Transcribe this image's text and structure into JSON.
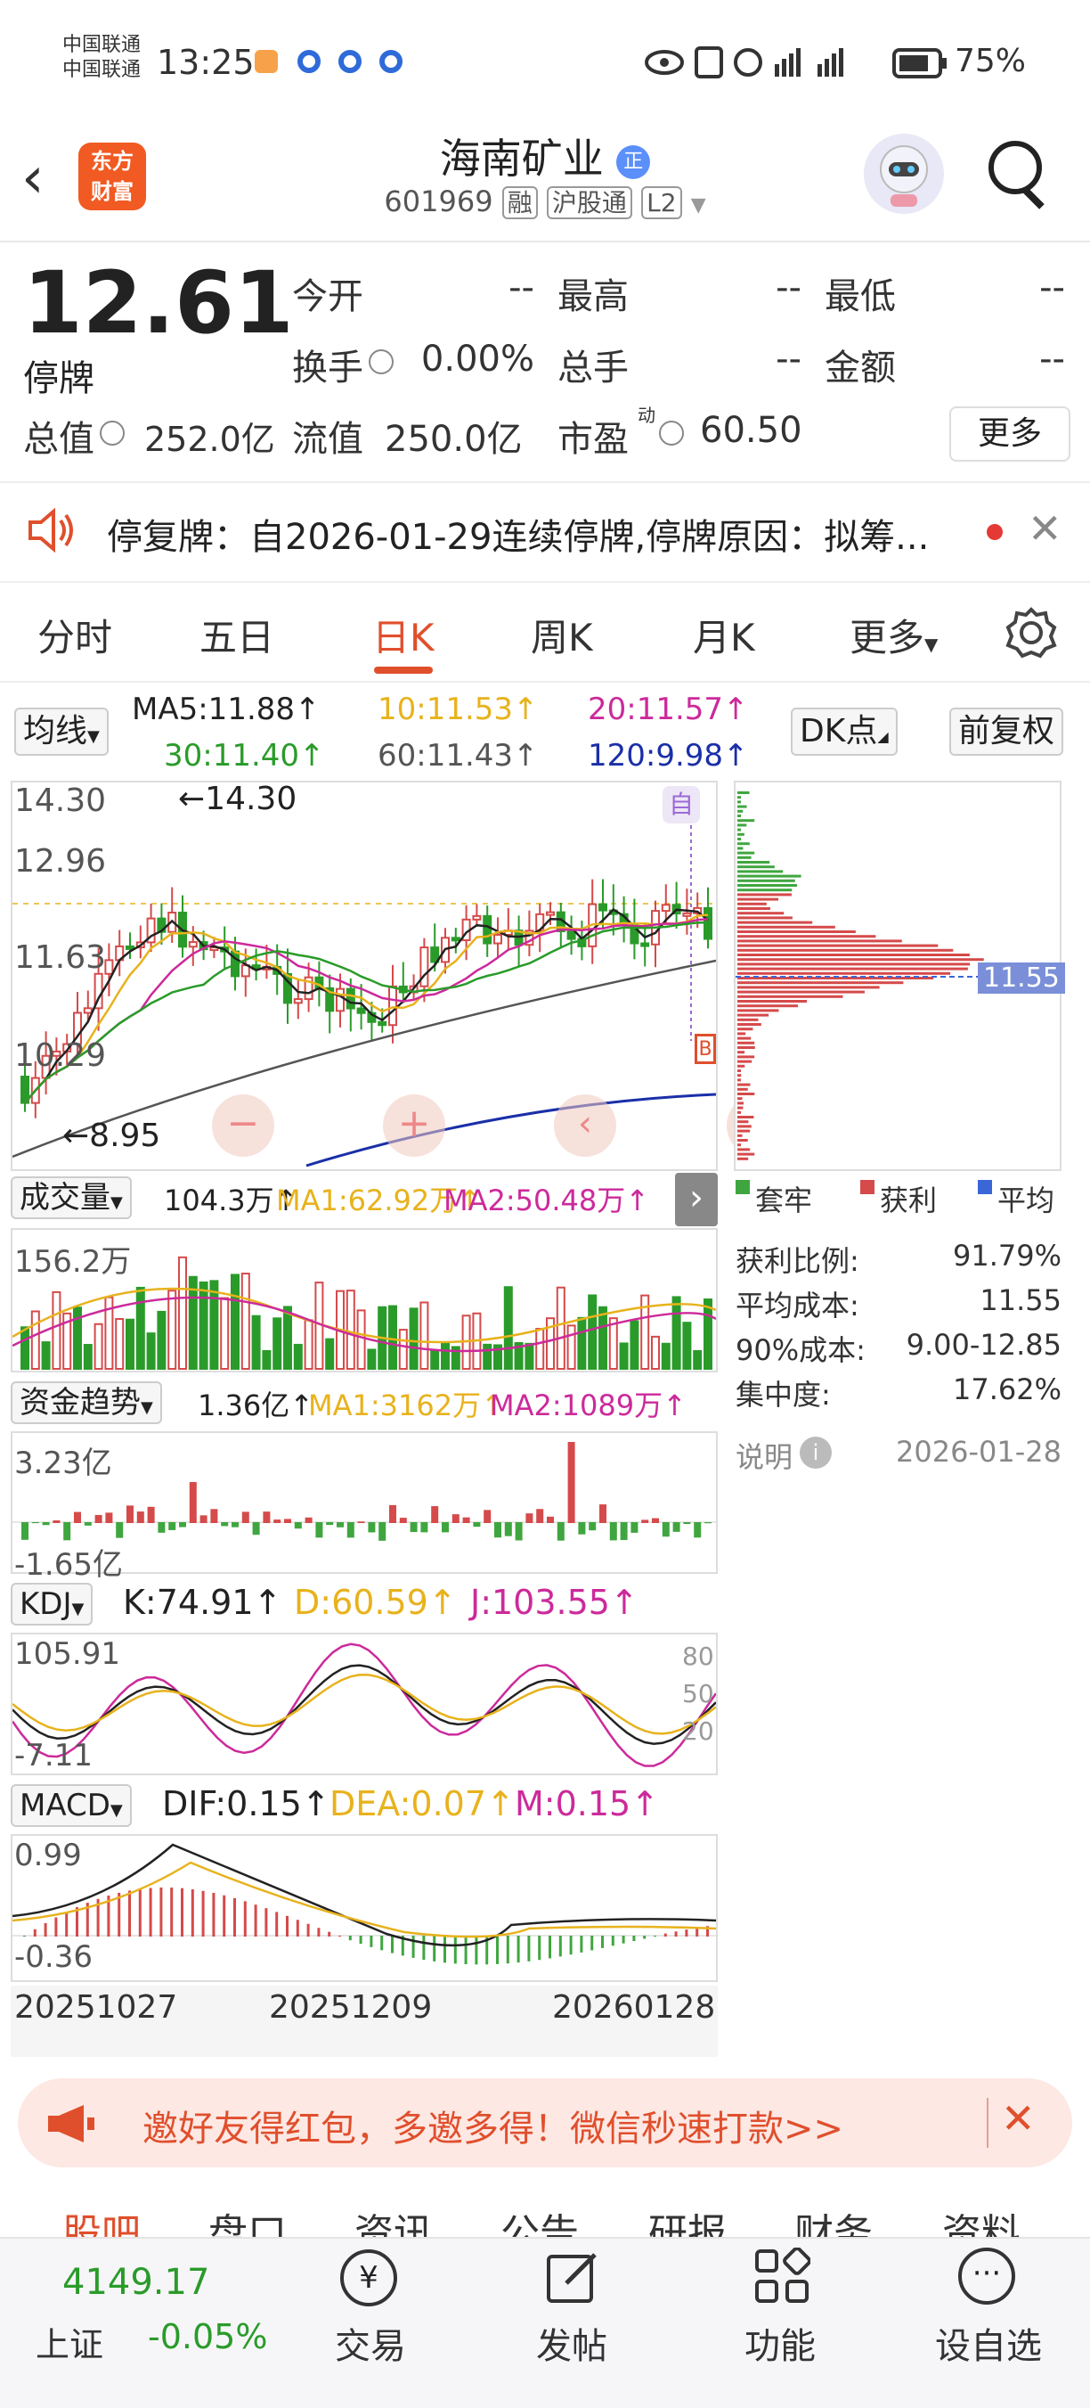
{
  "status": {
    "carrier1": "中国联通",
    "carrier2": "中国联通",
    "time": "13:25",
    "battery": "75%"
  },
  "header": {
    "title": "海南矿业",
    "badge": "正",
    "code": "601969",
    "tag_margin": "融",
    "tag_connect": "沪股通",
    "tag_level": "L2",
    "logo_line1": "东方",
    "logo_line2": "财富"
  },
  "quote": {
    "price": "12.61",
    "status": "停牌",
    "open_label": "今开",
    "open_value": "--",
    "high_label": "最高",
    "high_value": "--",
    "low_label": "最低",
    "low_value": "--",
    "turnover_label": "换手",
    "turnover_value": "0.00%",
    "volume_label": "总手",
    "volume_value": "--",
    "amount_label": "金额",
    "amount_value": "--",
    "mktcap_label": "总值",
    "mktcap_value": "252.0亿",
    "float_label": "流值",
    "float_value": "250.0亿",
    "pe_label": "市盈",
    "pe_sup": "动",
    "pe_value": "60.50",
    "more_label": "更多"
  },
  "notice": {
    "text": "停复牌：自2026-01-29连续停牌,停牌原因：拟筹..."
  },
  "tabs": [
    "分时",
    "五日",
    "日K",
    "周K",
    "月K",
    "更多"
  ],
  "active_tab": "日K",
  "ma_line": {
    "selector": "均线",
    "ma5": "MA5:11.88↑",
    "ma10": "10:11.53↑",
    "ma20": "20:11.57↑",
    "ma30": "30:11.40↑",
    "ma60": "60:11.43↑",
    "ma120": "120:9.98↑",
    "dk_label": "DK点",
    "fq_label": "前复权",
    "colors": {
      "ma5": "#222222",
      "ma10": "#e8b21c",
      "ma20": "#cc2a9b",
      "ma30": "#2a9b2a",
      "ma60": "#555555",
      "ma120": "#1a2fa8"
    }
  },
  "kchart": {
    "y_ticks": [
      "14.30",
      "12.96",
      "11.63",
      "10.29",
      "8.95"
    ],
    "high_annotation": "←14.30",
    "low_annotation": "←8.95",
    "auto_label": "自",
    "b_label": "B"
  },
  "volume": {
    "selector": "成交量",
    "value": "104.3万↑",
    "ma1": "MA1:62.92万↑",
    "ma2": "MA2:50.48万↑",
    "top_tick": "156.2万"
  },
  "fund": {
    "selector": "资金趋势",
    "value": "1.36亿↑",
    "ma1": "MA1:3162万↑",
    "ma2": "MA2:1089万↑",
    "top_tick": "3.23亿",
    "bottom_tick": "-1.65亿"
  },
  "kdj": {
    "selector": "KDJ",
    "k": "K:74.91↑",
    "d": "D:60.59↑",
    "j": "J:103.55↑",
    "top_tick": "105.91",
    "bottom_tick": "-7.11",
    "r80": "80",
    "r50": "50",
    "r20": "20"
  },
  "macd": {
    "selector": "MACD",
    "dif": "DIF:0.15↑",
    "dea": "DEA:0.07↑",
    "m": "M:0.15↑",
    "top_tick": "0.99",
    "bottom_tick": "-0.36",
    "dates": [
      "20251027",
      "20251209",
      "20260128"
    ]
  },
  "chip": {
    "avg_label": "11.55",
    "legend_trapped": "套牢",
    "legend_profit": "获利",
    "legend_avg": "平均",
    "profit_ratio_label": "获利比例:",
    "profit_ratio_value": "91.79%",
    "avg_cost_label": "平均成本:",
    "avg_cost_value": "11.55",
    "cost90_label": "90%成本:",
    "cost90_value": "9.00-12.85",
    "concentration_label": "集中度:",
    "concentration_value": "17.62%",
    "note_label": "说明",
    "note_date": "2026-01-28"
  },
  "banner": {
    "text": "邀好友得红包，多邀多得！微信秒速打款>>"
  },
  "bottom_tabs": [
    "股吧",
    "盘口",
    "资讯",
    "公告",
    "研报",
    "财务",
    "资料"
  ],
  "footer": {
    "index_value": "4149.17",
    "index_name": "上证",
    "index_change": "-0.05%",
    "trade": "交易",
    "post": "发帖",
    "func": "功能",
    "watch": "设自选"
  }
}
